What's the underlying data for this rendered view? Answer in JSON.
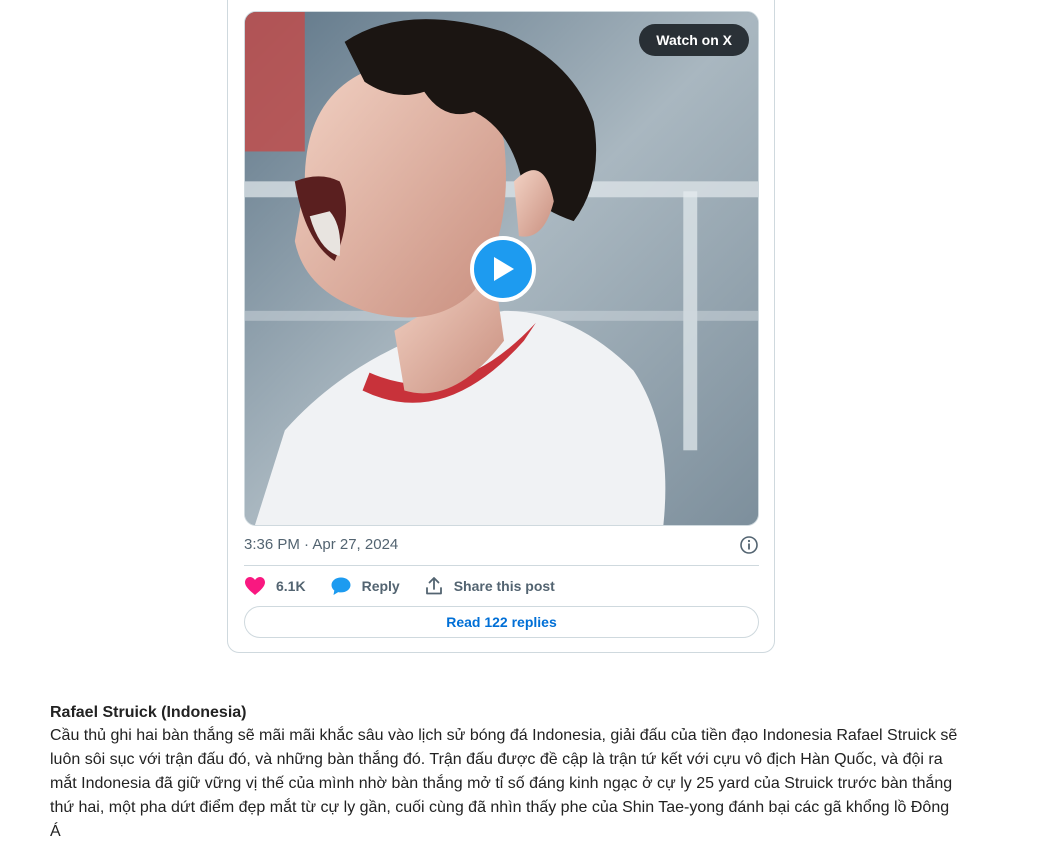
{
  "tweet": {
    "watch_label": "Watch on X",
    "timestamp": "3:36 PM · Apr 27, 2024",
    "likes": "6.1K",
    "reply_label": "Reply",
    "share_label": "Share this post",
    "read_replies_label": "Read 122 replies",
    "icons": {
      "like": "heart-icon",
      "reply": "speech-bubble-icon",
      "share": "share-upload-icon",
      "info": "info-icon",
      "play": "play-icon"
    },
    "colors": {
      "like": "#f91880",
      "play": "#1d9bf0",
      "link": "#006fd6"
    }
  },
  "article": {
    "heading": "Rafael Struick (Indonesia)",
    "body": "Cầu thủ ghi hai bàn thắng sẽ mãi mãi khắc sâu vào lịch sử bóng đá Indonesia, giải đấu của tiền đạo Indonesia Rafael Struick sẽ luôn sôi sục với trận đấu đó, và những bàn thắng đó. Trận đấu được đề cập là trận tứ kết với cựu vô địch Hàn Quốc, và đội ra mắt Indonesia đã giữ vững vị thế của mình nhờ bàn thắng mở tỉ số đáng kinh ngạc ở cự ly 25 yard của Struick trước bàn thắng thứ hai, một pha dứt điểm đẹp mắt từ cự ly gần, cuối cùng đã nhìn thấy phe của Shin Tae-yong đánh bại các gã khổng lồ Đông Á"
  }
}
